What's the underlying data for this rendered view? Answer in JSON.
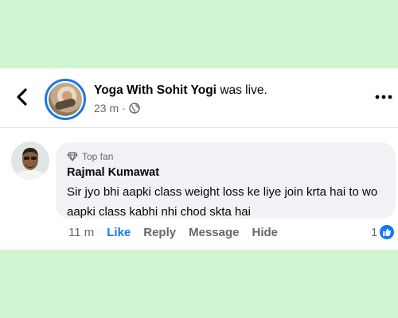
{
  "header": {
    "page_name": "Yoga With Sohit Yogi",
    "status_text": "was live.",
    "time_ago": "23 m",
    "separator": "·",
    "audience_icon": "globe-icon",
    "back_icon": "chevron-left-icon",
    "more_icon": "more-dots-icon"
  },
  "comment": {
    "badge": "Top fan",
    "badge_icon": "diamond-icon",
    "author": "Rajmal Kumawat",
    "text": "Sir jyo bhi aapki class weight loss ke liye join krta hai to wo aapki class kabhi nhi chod skta hai",
    "time_ago": "11 m",
    "actions": {
      "like": "Like",
      "reply": "Reply",
      "message": "Message",
      "hide": "Hide"
    },
    "reaction_count": "1",
    "reaction_icon": "like-thumb-icon"
  },
  "colors": {
    "background": "#d0f5d0",
    "accent": "#1877f2",
    "bubble": "#f0f2f5",
    "secondary_text": "#65676b"
  }
}
